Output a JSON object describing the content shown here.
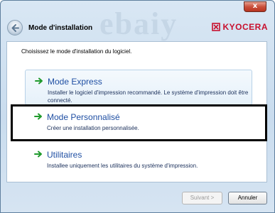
{
  "window": {
    "title": "Mode d'installation",
    "close_label": "x",
    "watermark_text": "ebaiy"
  },
  "brand": {
    "name": "KYOCERA",
    "color": "#c8102e"
  },
  "icons": {
    "back": "back-arrow-icon",
    "option": "green-arrow-icon",
    "logo": "kyocera-logo-icon"
  },
  "colors": {
    "option_title": "#1f4fa3",
    "option_arrow": "#1f9a2c",
    "highlight": "#000000"
  },
  "content": {
    "prompt": "Choisissez le mode d'installation du logiciel.",
    "options": [
      {
        "title": "Mode Express",
        "description": "Installer le logiciel d'impression recommandé. Le système d'impression doit être connecté."
      },
      {
        "title": "Mode Personnalisé",
        "description": "Créer une installation personnalisée."
      },
      {
        "title": "Utilitaires",
        "description": "Installee uniquement les utilitaires du système d'impression."
      }
    ]
  },
  "buttons": {
    "next": {
      "label": "Suivant >",
      "enabled": false
    },
    "cancel": {
      "label": "Annuler",
      "enabled": true
    }
  }
}
